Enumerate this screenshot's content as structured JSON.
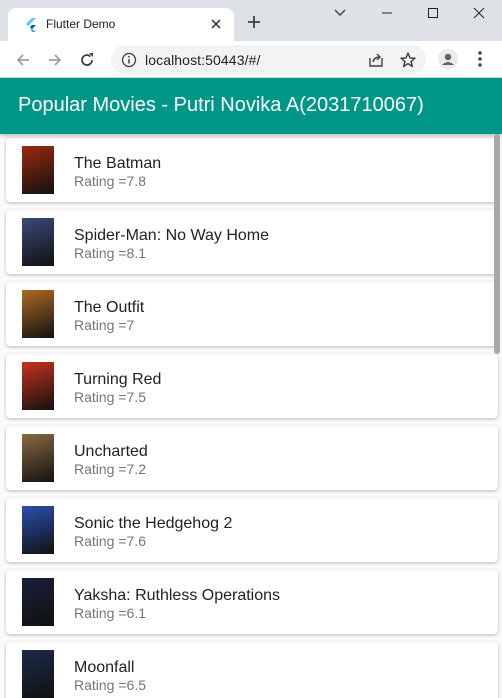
{
  "browser": {
    "tab_title": "Flutter Demo",
    "url": "localhost:50443/#/"
  },
  "app": {
    "title": "Popular Movies - Putri Novika A(2031710067)",
    "accent_color": "#009688"
  },
  "movies": [
    {
      "title": "The Batman",
      "rating": "Rating =7.8",
      "poster_color": "#9a2a10"
    },
    {
      "title": "Spider-Man: No Way Home",
      "rating": "Rating =8.1",
      "poster_color": "#3a4a7a"
    },
    {
      "title": "The Outfit",
      "rating": "Rating =7",
      "poster_color": "#b06a24"
    },
    {
      "title": "Turning Red",
      "rating": "Rating =7.5",
      "poster_color": "#c8321e"
    },
    {
      "title": "Uncharted",
      "rating": "Rating =7.2",
      "poster_color": "#8a6a42"
    },
    {
      "title": "Sonic the Hedgehog 2",
      "rating": "Rating =7.6",
      "poster_color": "#2a4fb0"
    },
    {
      "title": "Yaksha: Ruthless Operations",
      "rating": "Rating =6.1",
      "poster_color": "#1a1f3a"
    },
    {
      "title": "Moonfall",
      "rating": "Rating =6.5",
      "poster_color": "#1c2a4a"
    }
  ]
}
